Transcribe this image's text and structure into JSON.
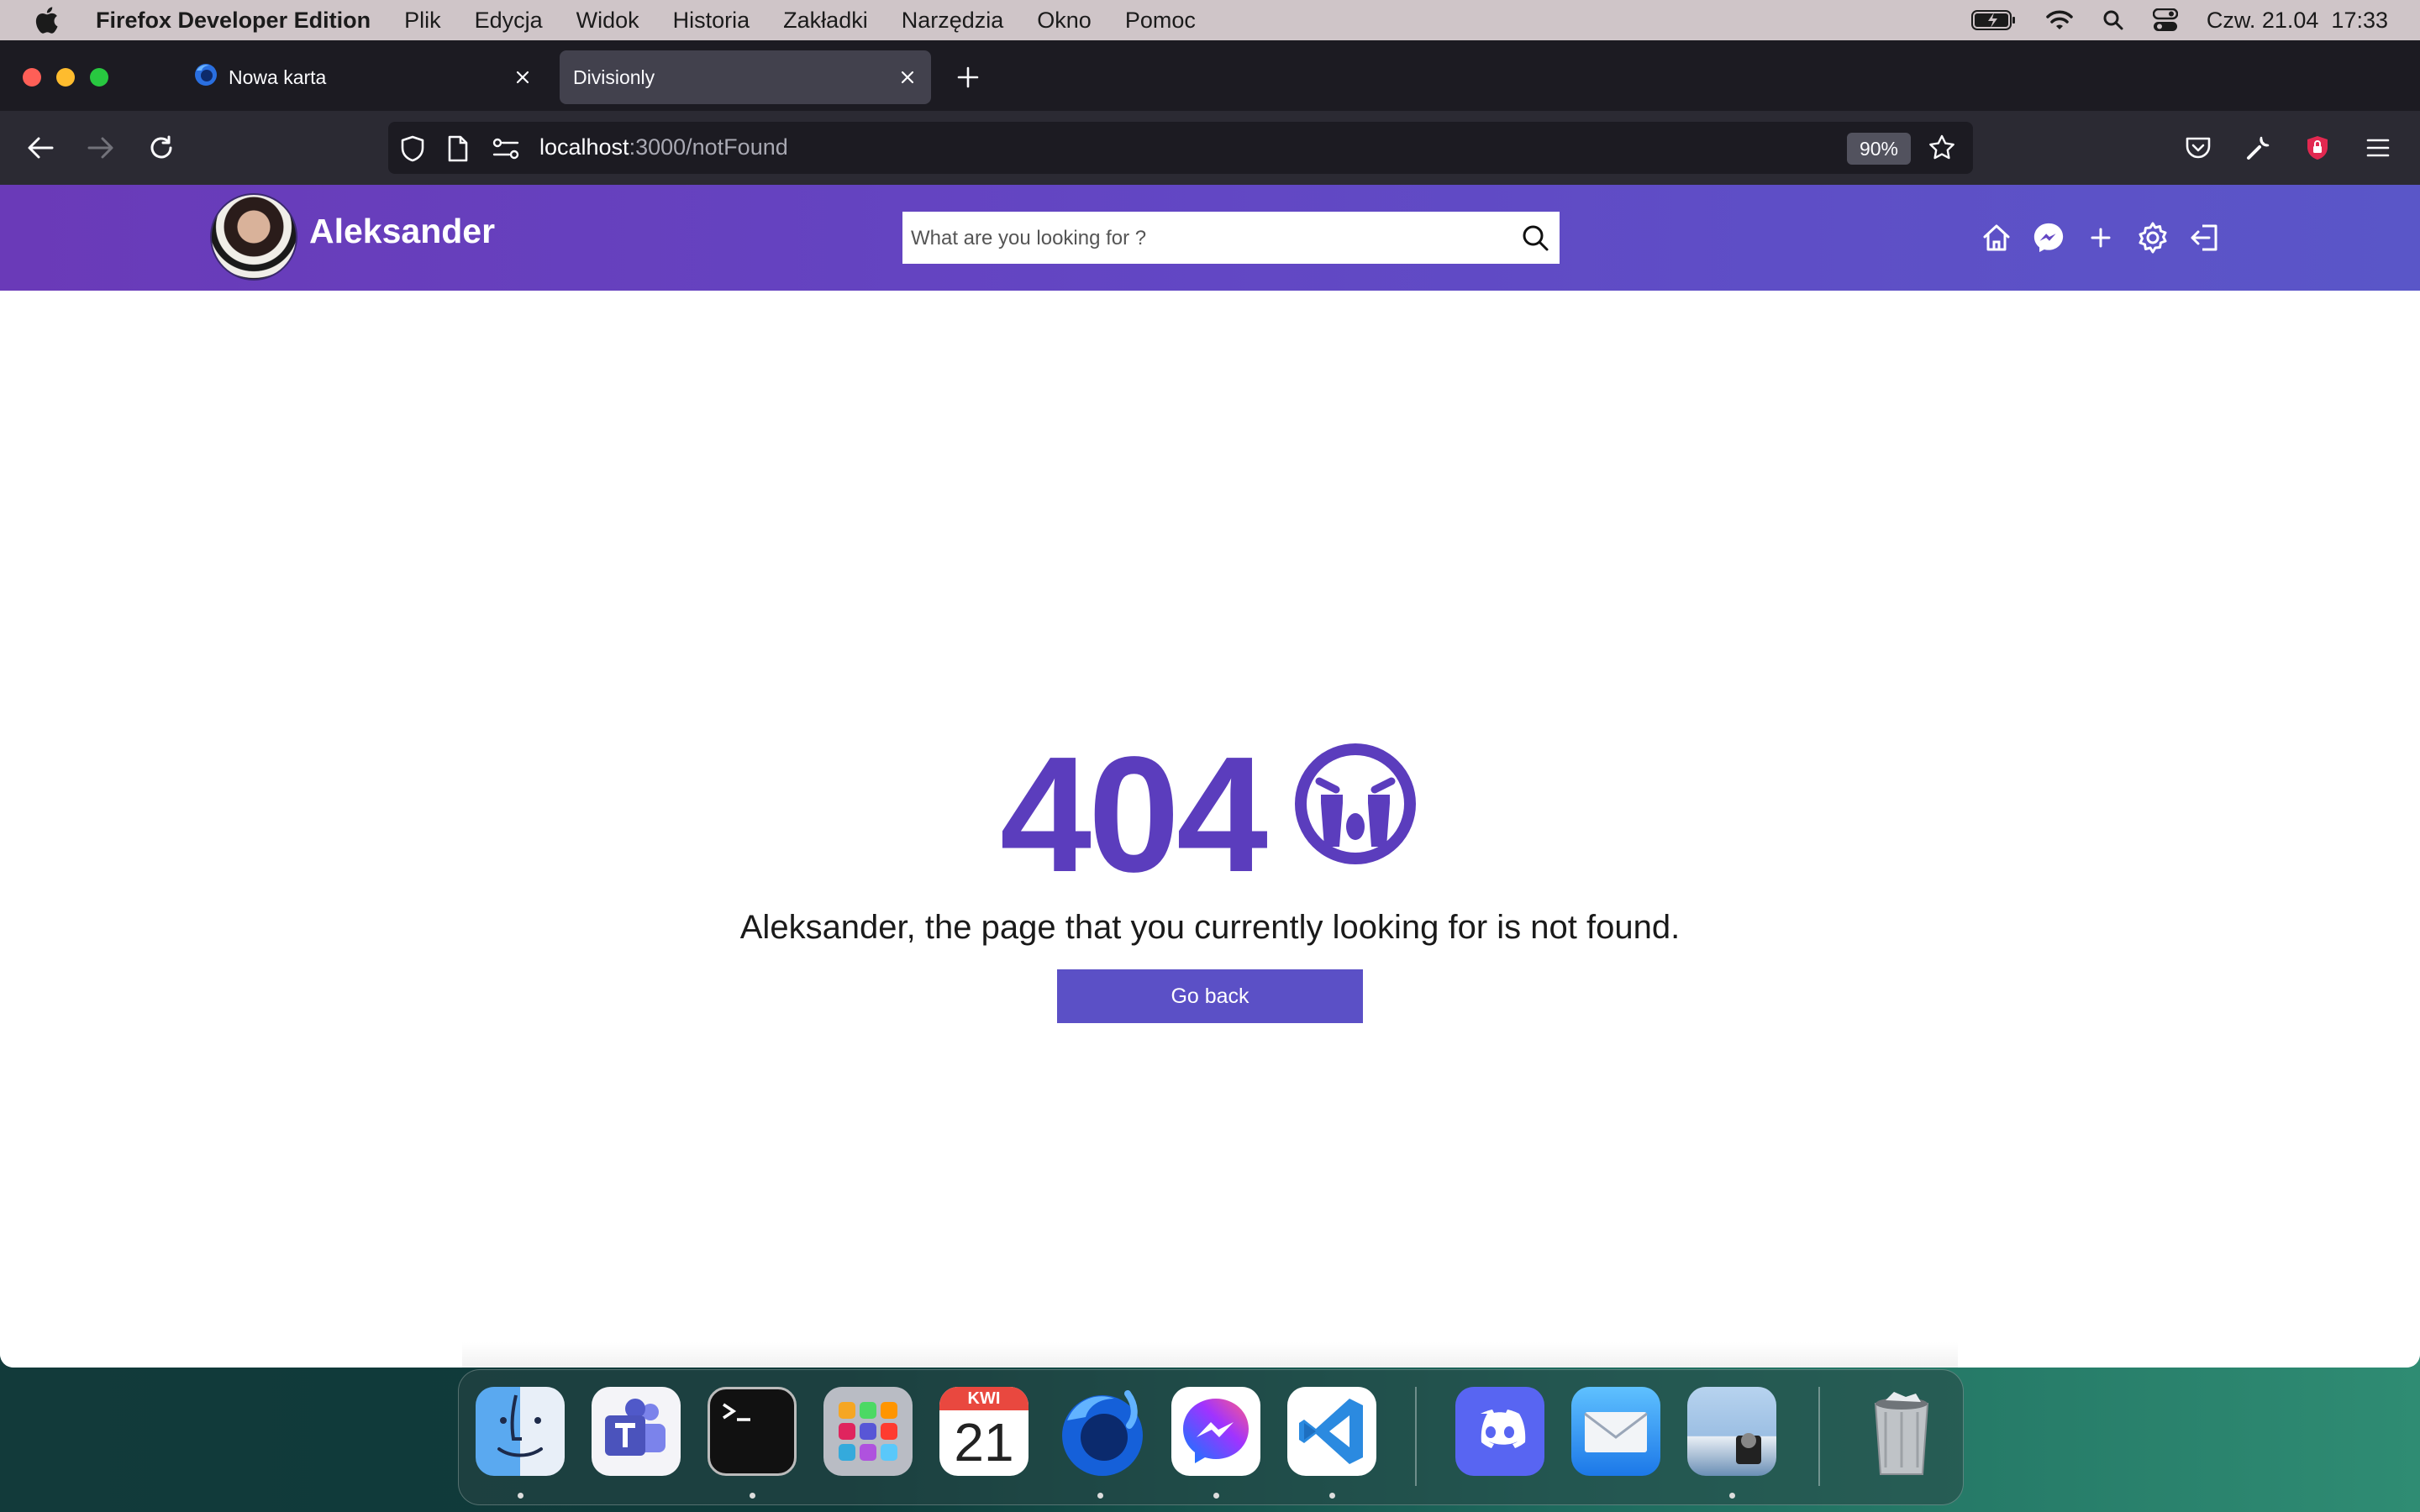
{
  "menubar": {
    "app_name": "Firefox Developer Edition",
    "menus": [
      "Plik",
      "Edycja",
      "Widok",
      "Historia",
      "Zakładki",
      "Narzędzia",
      "Okno",
      "Pomoc"
    ],
    "datetime": "Czw. 21.04  17:33"
  },
  "tabs": [
    {
      "label": "Nowa karta",
      "active": false
    },
    {
      "label": "Divisionly",
      "active": true
    }
  ],
  "urlbar": {
    "host": "localhost",
    "path": ":3000/notFound",
    "zoom": "90%"
  },
  "header": {
    "username": "Aleksander",
    "search_placeholder": "What are you looking for ?"
  },
  "notfound": {
    "code": "404",
    "message": "Aleksander, the page that you currently looking for is not found.",
    "button_label": "Go back"
  },
  "dock": {
    "calendar_month": "KWI",
    "calendar_day": "21"
  },
  "colors": {
    "accent": "#5b3dbd",
    "header_gradient_start": "#6a3ab8",
    "header_gradient_end": "#5a56c8",
    "button": "#5b50c6"
  }
}
